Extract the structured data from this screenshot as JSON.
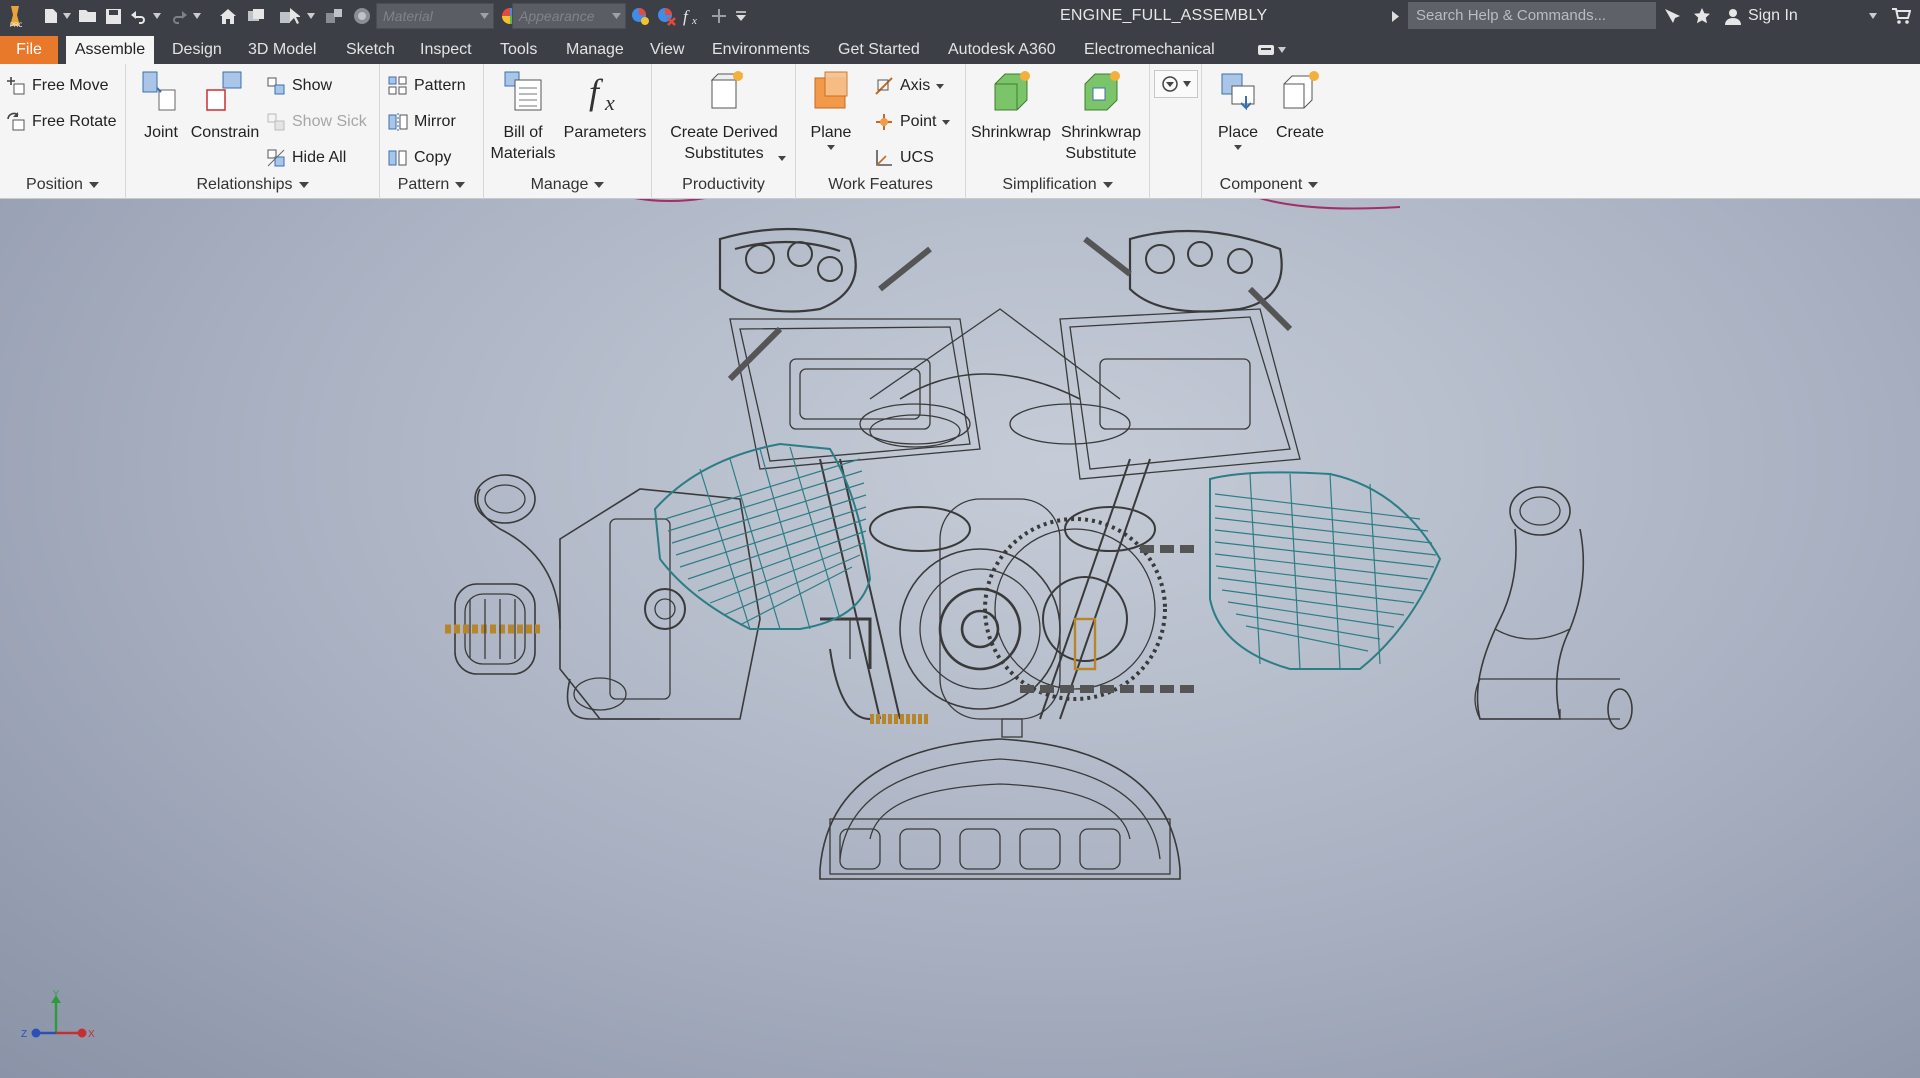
{
  "titlebar": {
    "document_title": "ENGINE_FULL_ASSEMBLY",
    "material_placeholder": "Material",
    "appearance_placeholder": "Appearance",
    "search_placeholder": "Search Help & Commands...",
    "sign_in": "Sign In",
    "icons": [
      "app-logo-icon",
      "new-icon",
      "open-icon",
      "save-icon",
      "undo-icon",
      "redo-icon",
      "home-icon",
      "return-icon",
      "select-icon",
      "update-icon",
      "color-sphere-icon",
      "appearance-icon",
      "clear-override-icon",
      "fx-icon",
      "plus-icon",
      "customize-icon"
    ]
  },
  "tabs": [
    {
      "label": "File"
    },
    {
      "label": "Assemble"
    },
    {
      "label": "Design"
    },
    {
      "label": "3D Model"
    },
    {
      "label": "Sketch"
    },
    {
      "label": "Inspect"
    },
    {
      "label": "Tools"
    },
    {
      "label": "Manage"
    },
    {
      "label": "View"
    },
    {
      "label": "Environments"
    },
    {
      "label": "Get Started"
    },
    {
      "label": "Autodesk A360"
    },
    {
      "label": "Electromechanical"
    }
  ],
  "ribbon": {
    "position": {
      "title": "Position",
      "free_move": "Free Move",
      "free_rotate": "Free Rotate"
    },
    "relationships": {
      "title": "Relationships",
      "joint": "Joint",
      "constrain": "Constrain",
      "show": "Show",
      "show_sick": "Show Sick",
      "hide_all": "Hide All"
    },
    "pattern": {
      "title": "Pattern",
      "pattern": "Pattern",
      "mirror": "Mirror",
      "copy": "Copy"
    },
    "manage": {
      "title": "Manage",
      "bom_line1": "Bill of",
      "bom_line2": "Materials",
      "parameters": "Parameters"
    },
    "productivity": {
      "title": "Productivity",
      "derived_line1": "Create Derived",
      "derived_line2": "Substitutes"
    },
    "work_features": {
      "title": "Work Features",
      "plane": "Plane",
      "axis": "Axis",
      "point": "Point",
      "ucs": "UCS"
    },
    "simplification": {
      "title": "Simplification",
      "shrinkwrap": "Shrinkwrap",
      "sub_line1": "Shrinkwrap",
      "sub_line2": "Substitute"
    },
    "component": {
      "title": "Component",
      "place": "Place",
      "create": "Create"
    }
  },
  "viewport": {
    "view_cube_axes": {
      "x": "X",
      "y": "Y",
      "z": "Z"
    },
    "colors": {
      "wire": "#3a3a3a",
      "cylinder": "#2d7d86",
      "accent": "#b8862a",
      "background": "#aab2c2"
    }
  }
}
